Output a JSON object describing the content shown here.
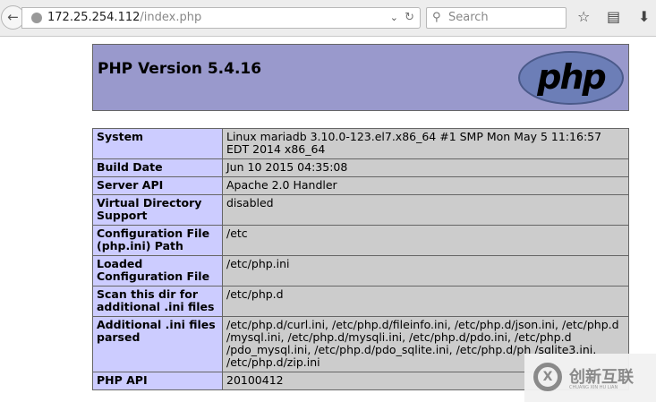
{
  "browser": {
    "url_host": "172.25.254.112",
    "url_path": "/index.php",
    "search_placeholder": "Search"
  },
  "header": {
    "title": "PHP Version 5.4.16",
    "logo_text": "php"
  },
  "rows": [
    {
      "label": "System",
      "value": "Linux mariadb 3.10.0-123.el7.x86_64 #1 SMP Mon May 5 11:16:57 EDT 2014 x86_64"
    },
    {
      "label": "Build Date",
      "value": "Jun 10 2015 04:35:08"
    },
    {
      "label": "Server API",
      "value": "Apache 2.0 Handler"
    },
    {
      "label": "Virtual Directory Support",
      "value": "disabled"
    },
    {
      "label": "Configuration File (php.ini) Path",
      "value": "/etc"
    },
    {
      "label": "Loaded Configuration File",
      "value": "/etc/php.ini"
    },
    {
      "label": "Scan this dir for additional .ini files",
      "value": "/etc/php.d"
    },
    {
      "label": "Additional .ini files parsed",
      "value": "/etc/php.d/curl.ini, /etc/php.d/fileinfo.ini, /etc/php.d/json.ini, /etc/php.d /mysql.ini, /etc/php.d/mysqli.ini, /etc/php.d/pdo.ini, /etc/php.d /pdo_mysql.ini, /etc/php.d/pdo_sqlite.ini, /etc/php.d/ph /sqlite3.ini, /etc/php.d/zip.ini"
    },
    {
      "label": "PHP API",
      "value": "20100412"
    }
  ],
  "watermark": {
    "text": "创新互联",
    "sub": "CHUANG XIN HU LIAN"
  }
}
